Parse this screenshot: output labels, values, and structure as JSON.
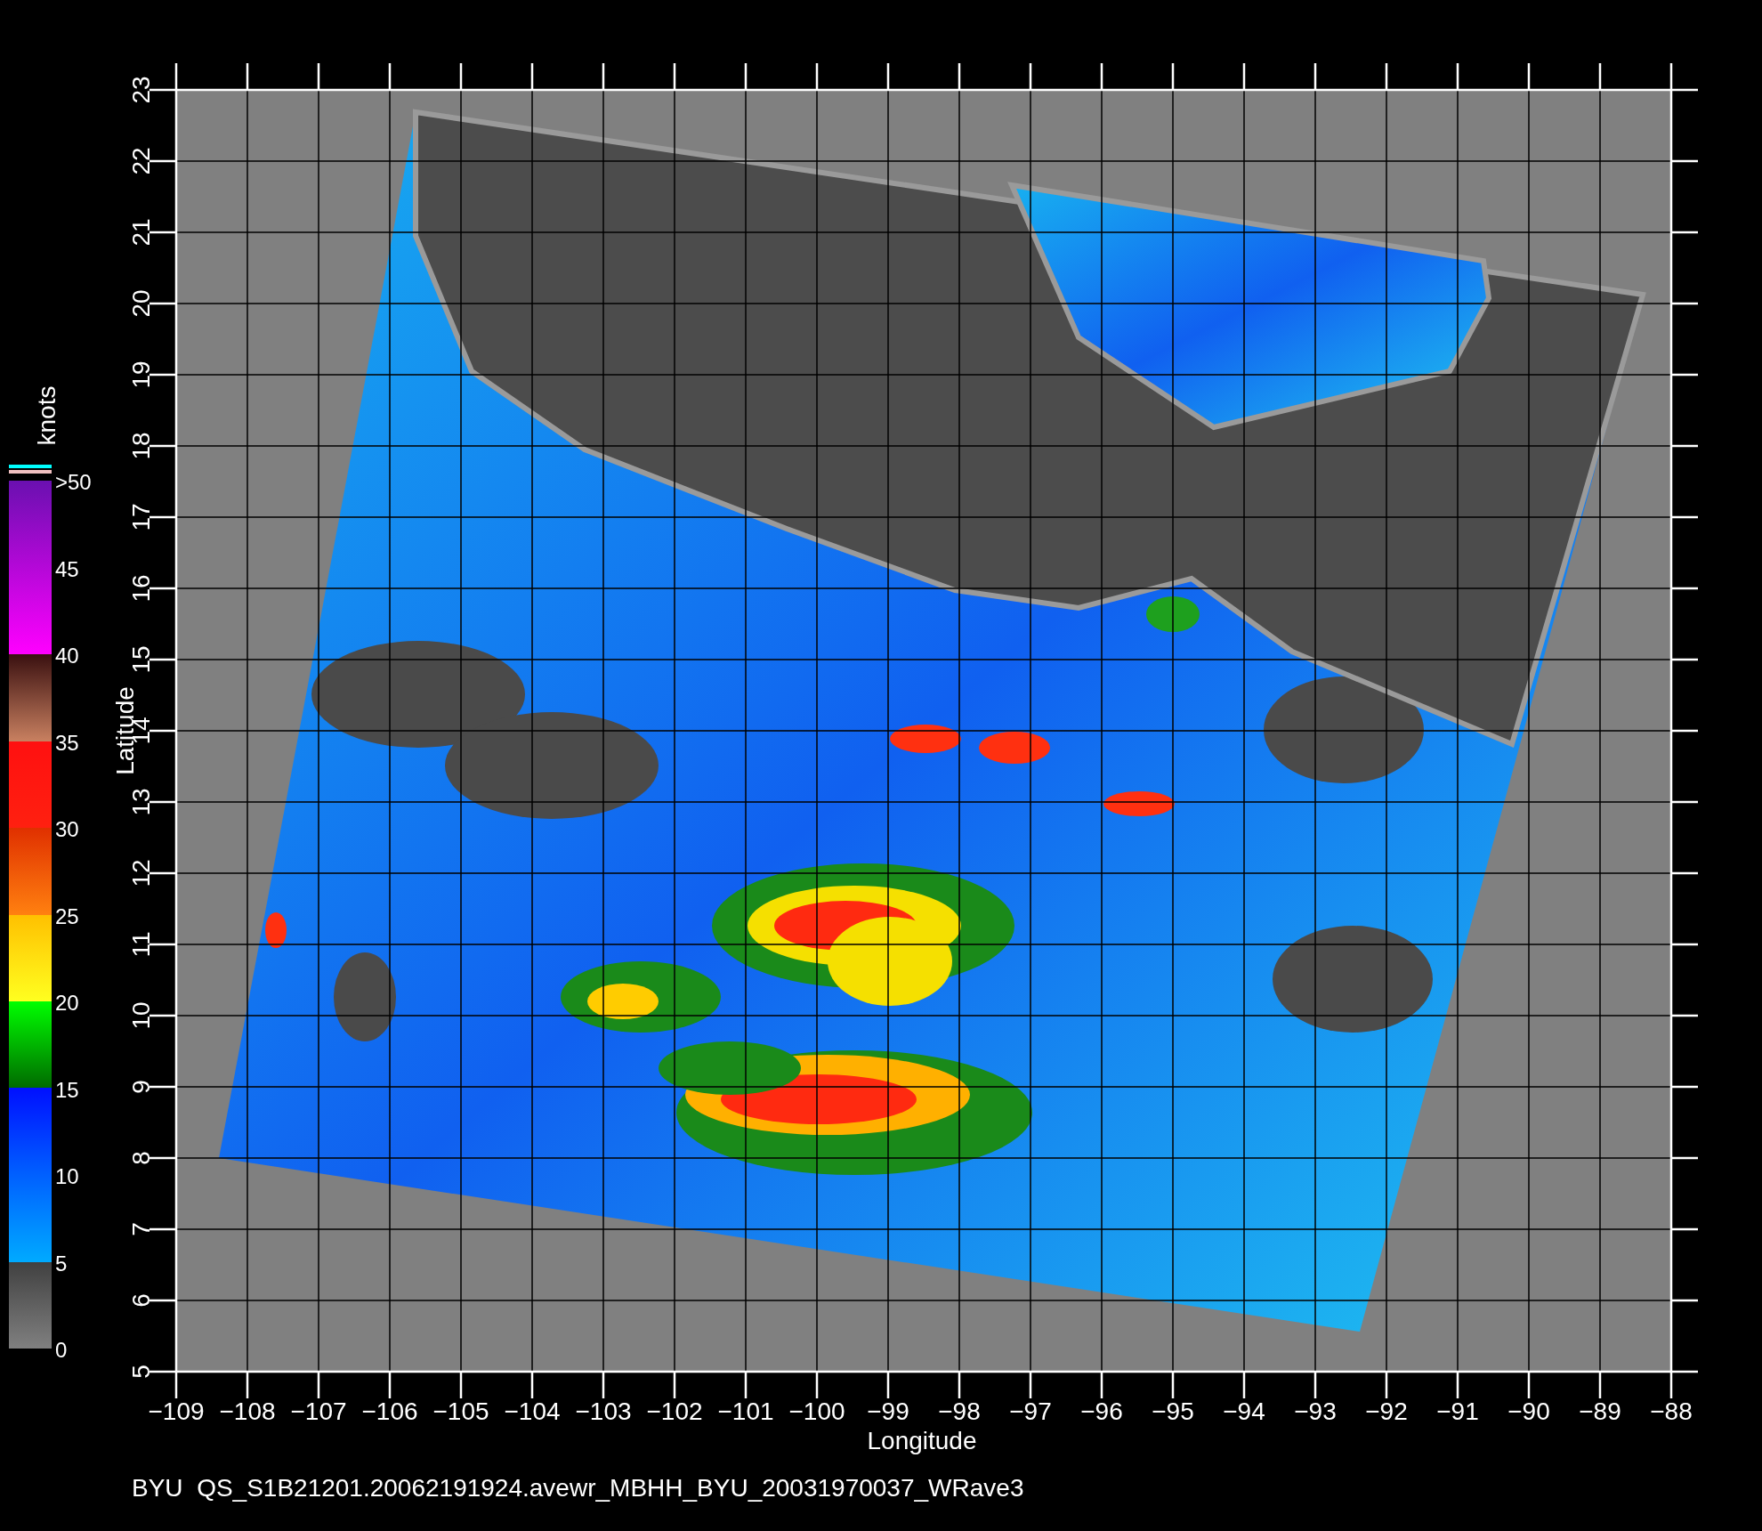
{
  "colorbar": {
    "unit": "knots",
    "labels": [
      ">50",
      "45",
      "40",
      "35",
      "30",
      "25",
      "20",
      "15",
      "10",
      "5",
      "0"
    ]
  },
  "map": {
    "xlabel": "Longitude",
    "ylabel": "Latitude",
    "xticks": [
      "−109",
      "−108",
      "−107",
      "−106",
      "−105",
      "−104",
      "−103",
      "−102",
      "−101",
      "−100",
      "−99",
      "−98",
      "−97",
      "−96",
      "−95",
      "−94",
      "−93",
      "−92",
      "−91",
      "−90",
      "−89",
      "−88"
    ],
    "yticks": [
      "5",
      "6",
      "7",
      "8",
      "9",
      "10",
      "11",
      "12",
      "13",
      "14",
      "15",
      "16",
      "17",
      "18",
      "19",
      "20",
      "21",
      "22",
      "23"
    ]
  },
  "caption": "BYU  QS_S1B21201.20062191924.avewr_MBHH_BYU_20031970037_WRave3"
}
